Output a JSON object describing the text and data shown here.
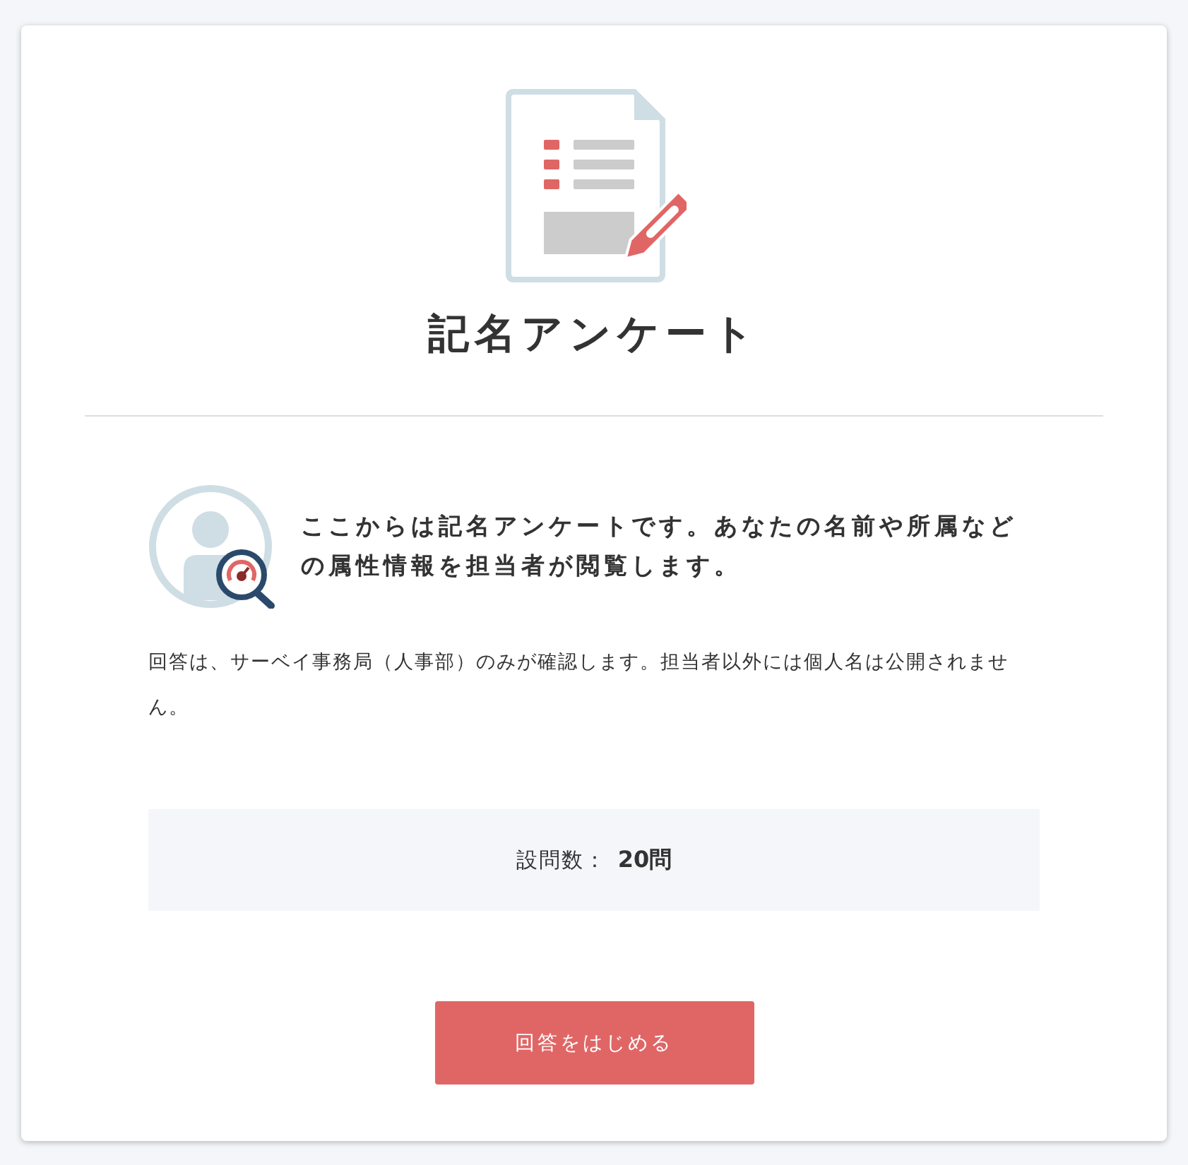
{
  "title": "記名アンケート",
  "lead": "ここからは記名アンケートです。あなたの名前や所属などの属性情報を担当者が閲覧します。",
  "note": "回答は、サーベイ事務局（人事部）のみが確認します。担当者以外には個人名は公開されません。",
  "question_count": {
    "label": "設問数：",
    "value": "20問"
  },
  "start_button": "回答をはじめる"
}
